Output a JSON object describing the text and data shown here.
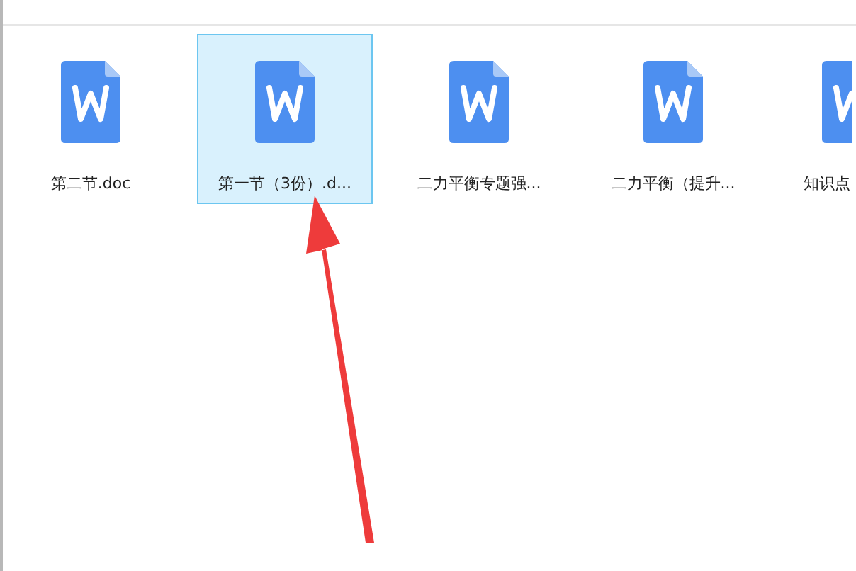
{
  "files": [
    {
      "name": "第二节.doc",
      "selected": false
    },
    {
      "name": "第一节（3份）.d...",
      "selected": true
    },
    {
      "name": "二力平衡专题强...",
      "selected": false
    },
    {
      "name": "二力平衡（提升...",
      "selected": false
    },
    {
      "name": "知识点",
      "selected": false
    }
  ]
}
